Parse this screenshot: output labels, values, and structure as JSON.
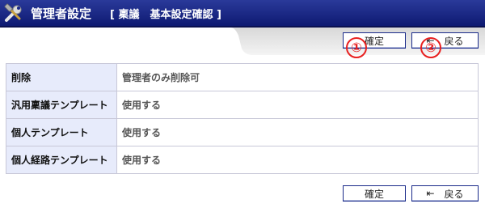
{
  "header": {
    "title": "管理者設定",
    "subtitle": "[ 稟議　基本設定確認 ]"
  },
  "toolbar": {
    "confirm_label": "確定",
    "back_label": "戻る"
  },
  "annotations": {
    "badge1": "①",
    "badge2": "②"
  },
  "settings": {
    "rows": [
      {
        "label": "削除",
        "value": "管理者のみ削除可"
      },
      {
        "label": "汎用稟議テンプレート",
        "value": "使用する"
      },
      {
        "label": "個人テンプレート",
        "value": "使用する"
      },
      {
        "label": "個人経路テンプレート",
        "value": "使用する"
      }
    ]
  },
  "colors": {
    "header_bg": "#1a2a8a",
    "label_bg": "#e7ebfb",
    "badge_red": "#e82020"
  },
  "icons": {
    "title": "tools-icon",
    "back": "back-arrow-icon"
  }
}
